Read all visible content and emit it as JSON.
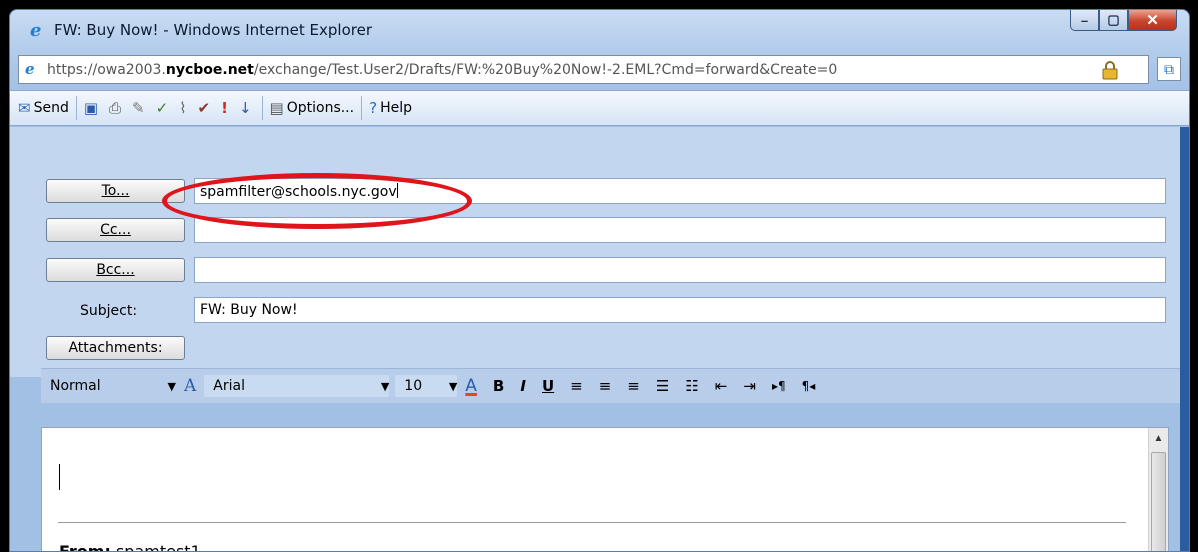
{
  "window": {
    "title": "FW: Buy Now! - Windows Internet Explorer",
    "controls": {
      "minimize": "–",
      "maximize": "▢",
      "close": "✕"
    }
  },
  "address": {
    "protocol": "https://",
    "subdomain": "owa2003.",
    "host": "nycboe.net",
    "path": "/exchange/Test.User2/Drafts/FW:%20Buy%20Now!-2.EML?Cmd=forward&Create=0"
  },
  "toolbar": {
    "send_label": "Send",
    "options_label": "Options...",
    "help_label": "Help"
  },
  "compose": {
    "to_button": "To...",
    "cc_button": "Cc...",
    "bcc_button": "Bcc...",
    "subject_label": "Subject:",
    "attachments_button": "Attachments:",
    "to_value": "spamfilter@schools.nyc.gov",
    "cc_value": "",
    "bcc_value": "",
    "subject_value": "FW: Buy Now!"
  },
  "format": {
    "style_value": "Normal",
    "font_value": "Arial",
    "size_value": "10"
  },
  "body": {
    "from_label": "From:",
    "from_value": "spamtest1"
  },
  "colors": {
    "highlight": "#e0141b"
  }
}
